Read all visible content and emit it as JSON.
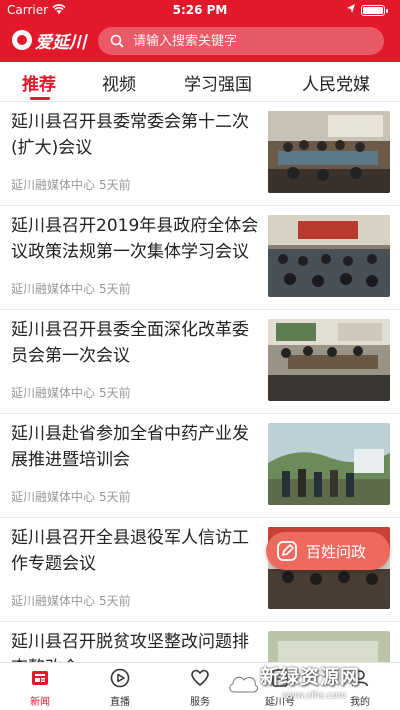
{
  "status_bar": {
    "carrier": "Carrier",
    "time": "5:26 PM",
    "battery_level": 1.0
  },
  "header": {
    "logo_text": "爱延川",
    "search_placeholder": "请输入搜索关键字",
    "accent_color": "#e1192b"
  },
  "tabs": [
    {
      "label": "推荐",
      "active": true
    },
    {
      "label": "视频",
      "active": false
    },
    {
      "label": "学习强国",
      "active": false
    },
    {
      "label": "人民党媒",
      "active": false
    }
  ],
  "feed": [
    {
      "title": "延川县召开县委常委会第十二次(扩大)会议",
      "source": "延川融媒体中心",
      "time": "5天前"
    },
    {
      "title": "延川县召开2019年县政府全体会议政策法规第一次集体学习会议",
      "source": "延川融媒体中心",
      "time": "5天前"
    },
    {
      "title": "延川县召开县委全面深化改革委员会第一次会议",
      "source": "延川融媒体中心",
      "time": "5天前"
    },
    {
      "title": "延川县赴省参加全省中药产业发展推进暨培训会",
      "source": "延川融媒体中心",
      "time": "5天前"
    },
    {
      "title": "延川县召开全县退役军人信访工作专题会议",
      "source": "延川融媒体中心",
      "time": "5天前"
    },
    {
      "title": "延川县召开脱贫攻坚整改问题排查整改会",
      "source": "",
      "time": ""
    }
  ],
  "floating_button": {
    "label": "百姓问政",
    "color": "#ee6a5f"
  },
  "bottom_nav": [
    {
      "label": "新闻",
      "icon": "news-icon",
      "active": true
    },
    {
      "label": "直播",
      "icon": "play-icon",
      "active": false
    },
    {
      "label": "服务",
      "icon": "service-icon",
      "active": false
    },
    {
      "label": "延川号",
      "icon": "account-icon",
      "active": false
    },
    {
      "label": "我的",
      "icon": "profile-icon",
      "active": false
    }
  ],
  "watermark": {
    "title": "新绿资源网",
    "url": "www.xlhs.com"
  }
}
